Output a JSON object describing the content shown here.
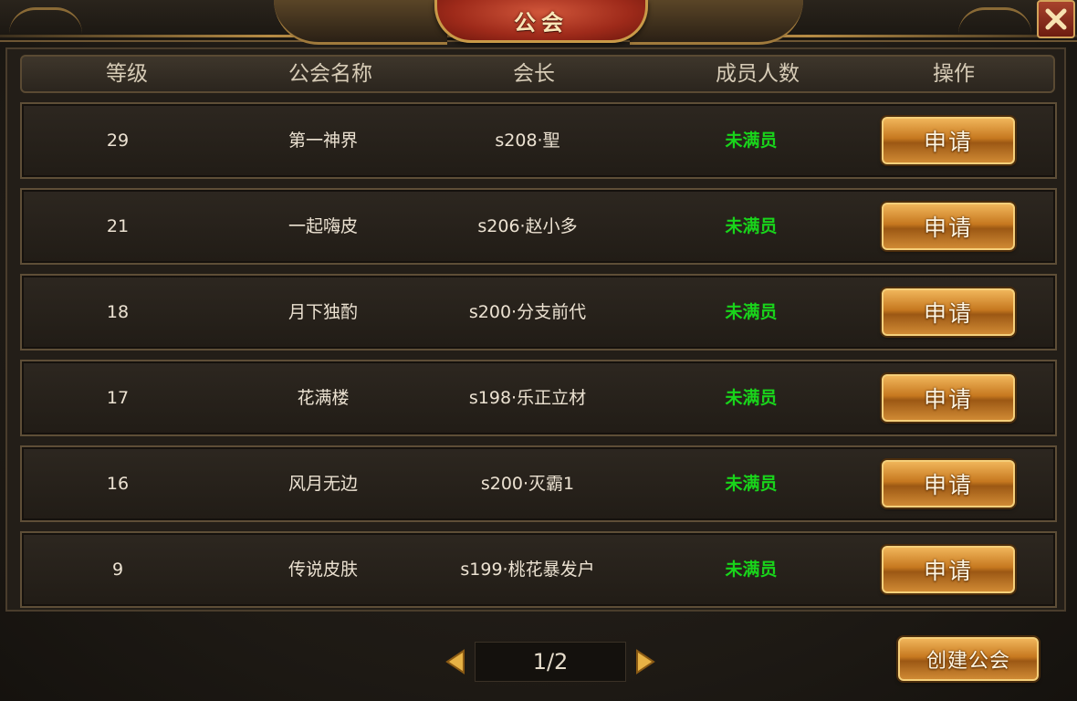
{
  "title": "公会",
  "columns": {
    "level": "等级",
    "name": "公会名称",
    "leader": "会长",
    "members": "成员人数",
    "action": "操作"
  },
  "guilds": [
    {
      "level": "29",
      "name": "第一神界",
      "leader": "s208·聖",
      "members": "未满员",
      "action": "申请"
    },
    {
      "level": "21",
      "name": "一起嗨皮",
      "leader": "s206·赵小多",
      "members": "未满员",
      "action": "申请"
    },
    {
      "level": "18",
      "name": "月下独酌",
      "leader": "s200·分支前代",
      "members": "未满员",
      "action": "申请"
    },
    {
      "level": "17",
      "name": "花满楼",
      "leader": "s198·乐正立材",
      "members": "未满员",
      "action": "申请"
    },
    {
      "level": "16",
      "name": "风月无边",
      "leader": "s200·灭霸1",
      "members": "未满员",
      "action": "申请"
    },
    {
      "level": "9",
      "name": "传说皮肤",
      "leader": "s199·桃花暴发户",
      "members": "未满员",
      "action": "申请"
    }
  ],
  "pagination": {
    "label": "1/2"
  },
  "create_button": "创建公会",
  "icons": {
    "close": "close-x-icon",
    "prev": "triangle-left-icon",
    "next": "triangle-right-icon"
  },
  "colors": {
    "status_green": "#19d41b",
    "gold": "#c99a48",
    "title_red": "#9e2a1a"
  }
}
